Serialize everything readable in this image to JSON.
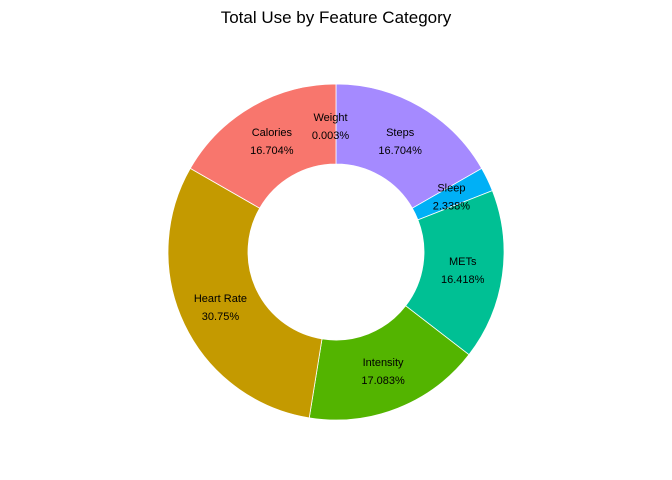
{
  "chart_data": {
    "type": "pie",
    "donut": true,
    "title": "Total Use by Feature Category",
    "legend": "none",
    "slices": [
      {
        "label": "Weight",
        "percent_text": "0.003%",
        "value": 0.003,
        "color": "#F8766D"
      },
      {
        "label": "Steps",
        "percent_text": "16.704%",
        "value": 16.704,
        "color": "#A58AFF"
      },
      {
        "label": "Sleep",
        "percent_text": "2.338%",
        "value": 2.338,
        "color": "#00B0F6"
      },
      {
        "label": "METs",
        "percent_text": "16.418%",
        "value": 16.418,
        "color": "#00C094"
      },
      {
        "label": "Intensity",
        "percent_text": "17.083%",
        "value": 17.083,
        "color": "#53B400"
      },
      {
        "label": "Heart Rate",
        "percent_text": "30.75%",
        "value": 30.75,
        "color": "#C49A00"
      },
      {
        "label": "Calories",
        "percent_text": "16.704%",
        "value": 16.704,
        "color": "#F8766D"
      }
    ]
  }
}
